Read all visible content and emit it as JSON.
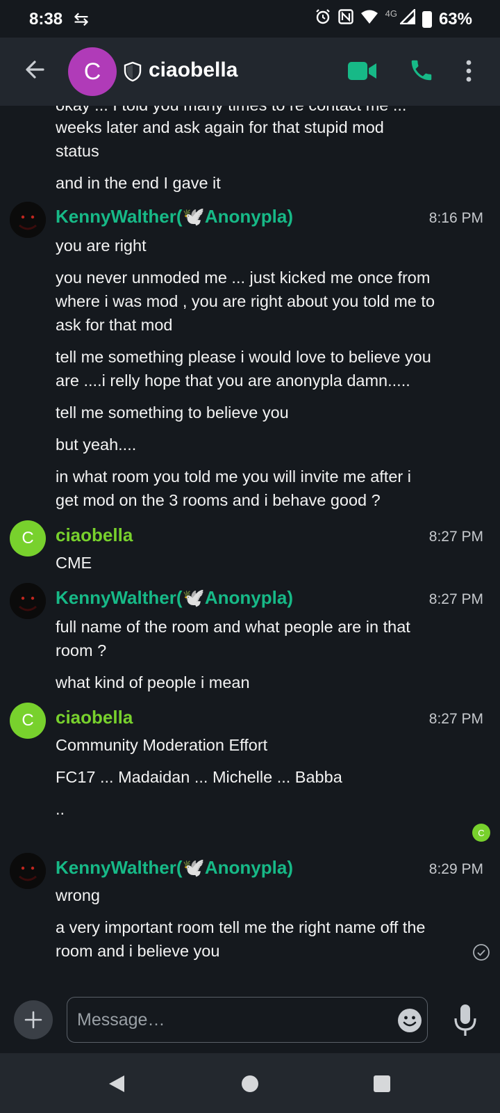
{
  "status_bar": {
    "time": "8:38",
    "network": "4G",
    "battery": "63%"
  },
  "header": {
    "avatar_letter": "C",
    "room_name": "ciaobella"
  },
  "timeline": {
    "cut_line": "okay ... I told you many times to re contact me ...",
    "m0_l1": "weeks later and ask again for that stupid mod",
    "m0_l2": "status",
    "m1": "and in the end I gave it",
    "g1": {
      "sender": "KennyWalther(🕊️Anonypla)",
      "time": "8:16 PM"
    },
    "g1_m1": "you are right",
    "g1_m2_l1": "you never unmoded me ... just kicked me once from",
    "g1_m2_l2": "where i was mod , you are right about you told me to",
    "g1_m2_l3": "ask for that mod",
    "g1_m3_l1": "tell me something please i would love to believe you",
    "g1_m3_l2": "are ....i relly hope that you are anonypla damn.....",
    "g1_m4": "tell me something to believe you",
    "g1_m5": "but yeah....",
    "g1_m6_l1": "in what room you told me you will invite me after i",
    "g1_m6_l2": "get mod on the 3 rooms and i behave good ?",
    "g2": {
      "sender": "ciaobella",
      "time": "8:27 PM",
      "avatar_letter": "C"
    },
    "g2_m1": "CME",
    "g3": {
      "sender": "KennyWalther(🕊️Anonypla)",
      "time": "8:27 PM"
    },
    "g3_m1_l1": "full name of the room and what people are in that",
    "g3_m1_l2": "room ?",
    "g3_m2": "what kind of people i mean",
    "g4": {
      "sender": "ciaobella",
      "time": "8:27 PM",
      "avatar_letter": "C"
    },
    "g4_m1": "Community Moderation Effort",
    "g4_m2": "FC17 ... Madaidan ... Michelle ... Babba",
    "g4_m3": "..",
    "read_receipt_letter": "C",
    "g5": {
      "sender": "KennyWalther(🕊️Anonypla)",
      "time": "8:29 PM"
    },
    "g5_m1": "wrong",
    "g5_m2_l1": "a very important room tell me the right name off the",
    "g5_m2_l2": "room and i believe you"
  },
  "composer": {
    "placeholder": "Message…"
  },
  "colors": {
    "background": "#15191e",
    "appbar": "#22272e",
    "kenny_name": "#17b987",
    "ciao_name": "#78d12d",
    "call_icons": "#17b987",
    "room_avatar": "#b03bb8"
  },
  "icons": [
    "back-arrow-icon",
    "shield-icon",
    "video-call-icon",
    "phone-icon",
    "more-icon",
    "plus-icon",
    "emoji-icon",
    "microphone-icon",
    "sent-check-icon",
    "alarm-icon",
    "nfc-icon",
    "wifi-icon",
    "signal-icon",
    "battery-icon",
    "sync-icon"
  ]
}
